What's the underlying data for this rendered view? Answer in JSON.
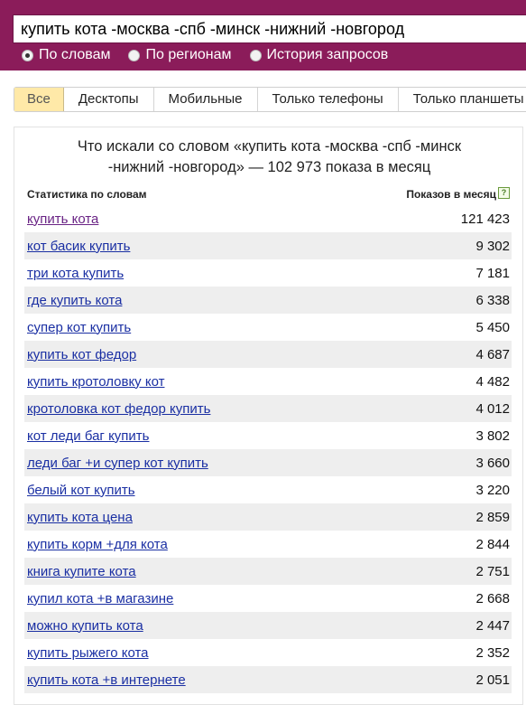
{
  "search": {
    "query": "купить кота -москва -спб -минск -нижний -новгород"
  },
  "radios": [
    {
      "label": "По словам",
      "checked": true
    },
    {
      "label": "По регионам",
      "checked": false
    },
    {
      "label": "История запросов",
      "checked": false
    }
  ],
  "tabs": [
    "Все",
    "Десктопы",
    "Мобильные",
    "Только телефоны",
    "Только планшеты"
  ],
  "card": {
    "title_line1": "Что искали со словом «купить кота -москва -спб -минск",
    "title_line2": "-нижний -новгород» — 102 973 показа в месяц",
    "col_phrase": "Статистика по словам",
    "col_count": "Показов в месяц",
    "help": "?"
  },
  "rows": [
    {
      "phrase": "купить кота",
      "count": "121 423"
    },
    {
      "phrase": "кот басик купить",
      "count": "9 302"
    },
    {
      "phrase": "три кота купить",
      "count": "7 181"
    },
    {
      "phrase": "где купить кота",
      "count": "6 338"
    },
    {
      "phrase": "супер кот купить",
      "count": "5 450"
    },
    {
      "phrase": "купить кот федор",
      "count": "4 687"
    },
    {
      "phrase": "купить кротоловку кот",
      "count": "4 482"
    },
    {
      "phrase": "кротоловка кот федор купить",
      "count": "4 012"
    },
    {
      "phrase": "кот леди баг купить",
      "count": "3 802"
    },
    {
      "phrase": "леди баг +и супер кот купить",
      "count": "3 660"
    },
    {
      "phrase": "белый кот купить",
      "count": "3 220"
    },
    {
      "phrase": "купить кота цена",
      "count": "2 859"
    },
    {
      "phrase": "купить корм +для кота",
      "count": "2 844"
    },
    {
      "phrase": "книга купите кота",
      "count": "2 751"
    },
    {
      "phrase": "купил кота +в магазине",
      "count": "2 668"
    },
    {
      "phrase": "можно купить кота",
      "count": "2 447"
    },
    {
      "phrase": "купить рыжего кота",
      "count": "2 352"
    },
    {
      "phrase": "купить кота +в интернете",
      "count": "2 051"
    }
  ]
}
